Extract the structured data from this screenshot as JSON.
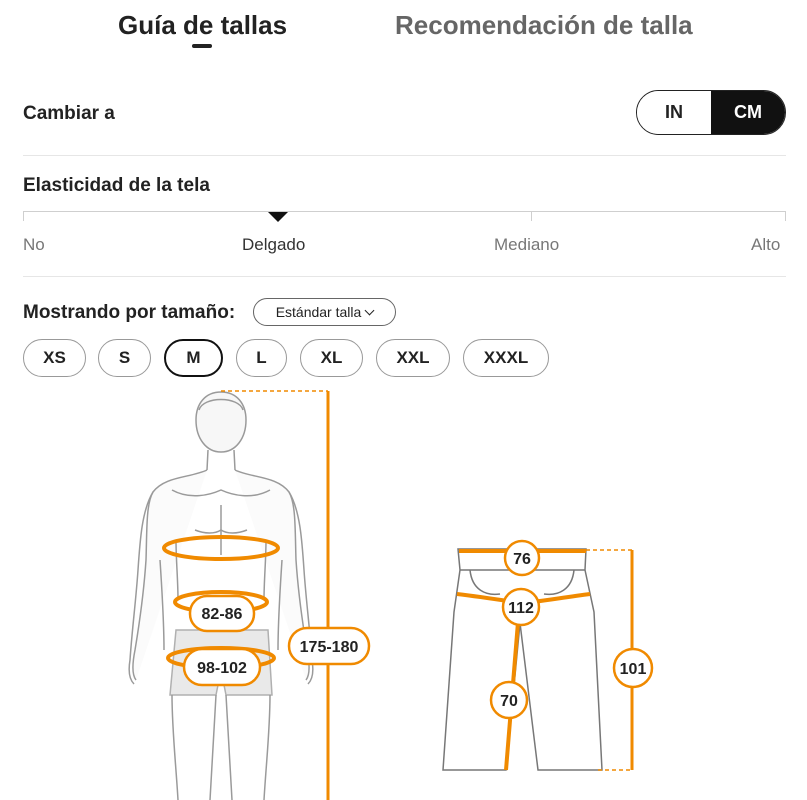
{
  "tabs": {
    "size_guide": "Guía de tallas",
    "recommendation": "Recomendación de talla"
  },
  "units": {
    "label": "Cambiar a",
    "options": [
      "IN",
      "CM"
    ],
    "selected": "CM"
  },
  "elasticity": {
    "title": "Elasticidad de la tela",
    "levels": [
      "No",
      "Delgado",
      "Mediano",
      "Alto"
    ],
    "selected": "Delgado"
  },
  "sizes": {
    "label": "Mostrando por tamaño:",
    "standard_select": "Estándar talla",
    "options": [
      "XS",
      "S",
      "M",
      "L",
      "XL",
      "XXL",
      "XXXL"
    ],
    "selected": "M"
  },
  "body_measurements": {
    "waist": "82-86",
    "hips": "98-102",
    "height": "175-180"
  },
  "garment_measurements": {
    "waist": "76",
    "hip": "112",
    "inseam": "70",
    "length": "101"
  },
  "colors": {
    "accent": "#f08a00",
    "dark": "#111111"
  }
}
